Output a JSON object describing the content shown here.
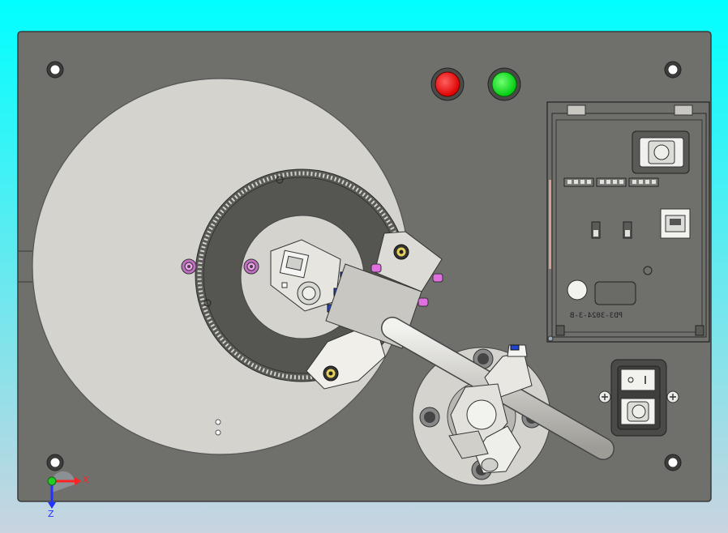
{
  "viewport": {
    "background_top": "#00ffff",
    "background_bottom": "#c9d4e0"
  },
  "colors": {
    "plate": "#6f6f6c",
    "plate_edge": "#3a3a3a",
    "disc": "#d4d3cd",
    "disc_dark": "#555552",
    "metal": "#c8c7c2",
    "rod": "#d9d8d3",
    "red_light": "#ee1111",
    "green_light": "#11dd22",
    "magenta_screw": "#e070e0",
    "blue_part": "#2244cc",
    "screw_gold": "#e6d25a"
  },
  "indicators": [
    {
      "name": "red-indicator",
      "color": "#ee1111"
    },
    {
      "name": "green-indicator",
      "color": "#11dd22"
    }
  ],
  "control_board": {
    "engraved_label": "PD3-3024-3-B"
  },
  "triad": {
    "x_label": "X",
    "z_label": "Z",
    "x_color": "#ff2222",
    "y_color": "#22cc22",
    "z_color": "#2233ff"
  }
}
